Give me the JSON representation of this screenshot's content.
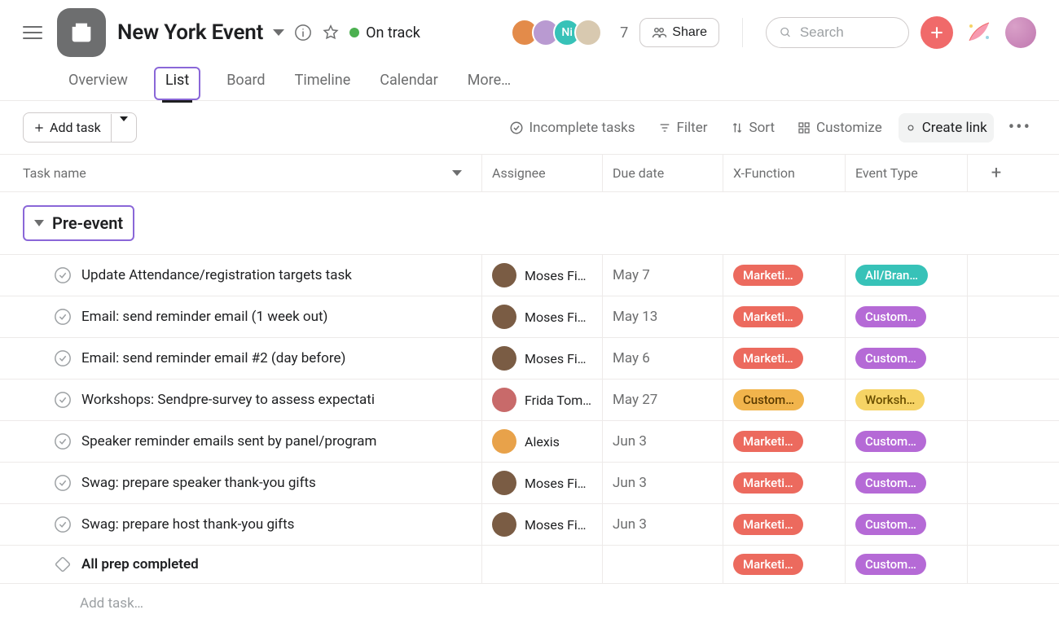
{
  "header": {
    "title": "New York Event",
    "status": "On track",
    "member_count": "7",
    "share_label": "Share",
    "search_placeholder": "Search",
    "avatars": [
      {
        "bg": "#e38b4a"
      },
      {
        "bg": "#b99ad1"
      },
      {
        "bg": "#37c2b8",
        "text": "Ni"
      },
      {
        "bg": "#d8c9b0"
      }
    ]
  },
  "tabs": {
    "items": [
      "Overview",
      "List",
      "Board",
      "Timeline",
      "Calendar",
      "More…"
    ],
    "active": "List"
  },
  "toolbar": {
    "add_task": "Add task",
    "incomplete": "Incomplete tasks",
    "filter": "Filter",
    "sort": "Sort",
    "customize": "Customize",
    "create_link": "Create link"
  },
  "columns": {
    "task_name": "Task name",
    "assignee": "Assignee",
    "due_date": "Due date",
    "x_function": "X-Function",
    "event_type": "Event Type"
  },
  "section": {
    "name": "Pre-event"
  },
  "tag_colors": {
    "Marketi…": "lbl-marketing",
    "Custom…_x": "lbl-customer",
    "All/Bran…": "evt-all",
    "Custom…": "evt-customer",
    "Worksh…": "evt-workshop"
  },
  "tasks": [
    {
      "name": "Update Attendance/registration targets task",
      "assignee": "Moses Fidel",
      "assignee_bg": "#7a5c44",
      "due": "May 7",
      "xfn": "Marketi…",
      "xfn_cls": "lbl-marketing",
      "evt": "All/Bran…",
      "evt_cls": "evt-all",
      "milestone": false
    },
    {
      "name": "Email: send reminder email (1 week out)",
      "assignee": "Moses Fidel",
      "assignee_bg": "#7a5c44",
      "due": "May 13",
      "xfn": "Marketi…",
      "xfn_cls": "lbl-marketing",
      "evt": "Custom…",
      "evt_cls": "evt-customer",
      "milestone": false
    },
    {
      "name": "Email: send reminder email #2 (day before)",
      "assignee": "Moses Fidel",
      "assignee_bg": "#7a5c44",
      "due": "May 6",
      "xfn": "Marketi…",
      "xfn_cls": "lbl-marketing",
      "evt": "Custom…",
      "evt_cls": "evt-customer",
      "milestone": false
    },
    {
      "name": "Workshops: Sendpre-survey to assess expectati",
      "assignee": "Frida Toms…",
      "assignee_bg": "#c86a6a",
      "due": "May 27",
      "xfn": "Custom…",
      "xfn_cls": "lbl-customer",
      "evt": "Worksh…",
      "evt_cls": "evt-workshop",
      "milestone": false
    },
    {
      "name": "Speaker reminder emails sent by panel/program",
      "assignee": "Alexis",
      "assignee_bg": "#e8a24a",
      "due": "Jun 3",
      "xfn": "Marketi…",
      "xfn_cls": "lbl-marketing",
      "evt": "Custom…",
      "evt_cls": "evt-customer",
      "milestone": false
    },
    {
      "name": "Swag: prepare speaker thank-you gifts",
      "assignee": "Moses Fidel",
      "assignee_bg": "#7a5c44",
      "due": "Jun 3",
      "xfn": "Marketi…",
      "xfn_cls": "lbl-marketing",
      "evt": "Custom…",
      "evt_cls": "evt-customer",
      "milestone": false
    },
    {
      "name": "Swag: prepare host thank-you gifts",
      "assignee": "Moses Fidel",
      "assignee_bg": "#7a5c44",
      "due": "Jun 3",
      "xfn": "Marketi…",
      "xfn_cls": "lbl-marketing",
      "evt": "Custom…",
      "evt_cls": "evt-customer",
      "milestone": false
    },
    {
      "name": "All prep completed",
      "assignee": "",
      "assignee_bg": "",
      "due": "",
      "xfn": "Marketi…",
      "xfn_cls": "lbl-marketing",
      "evt": "Custom…",
      "evt_cls": "evt-customer",
      "milestone": true
    }
  ],
  "add_task_placeholder": "Add task…"
}
